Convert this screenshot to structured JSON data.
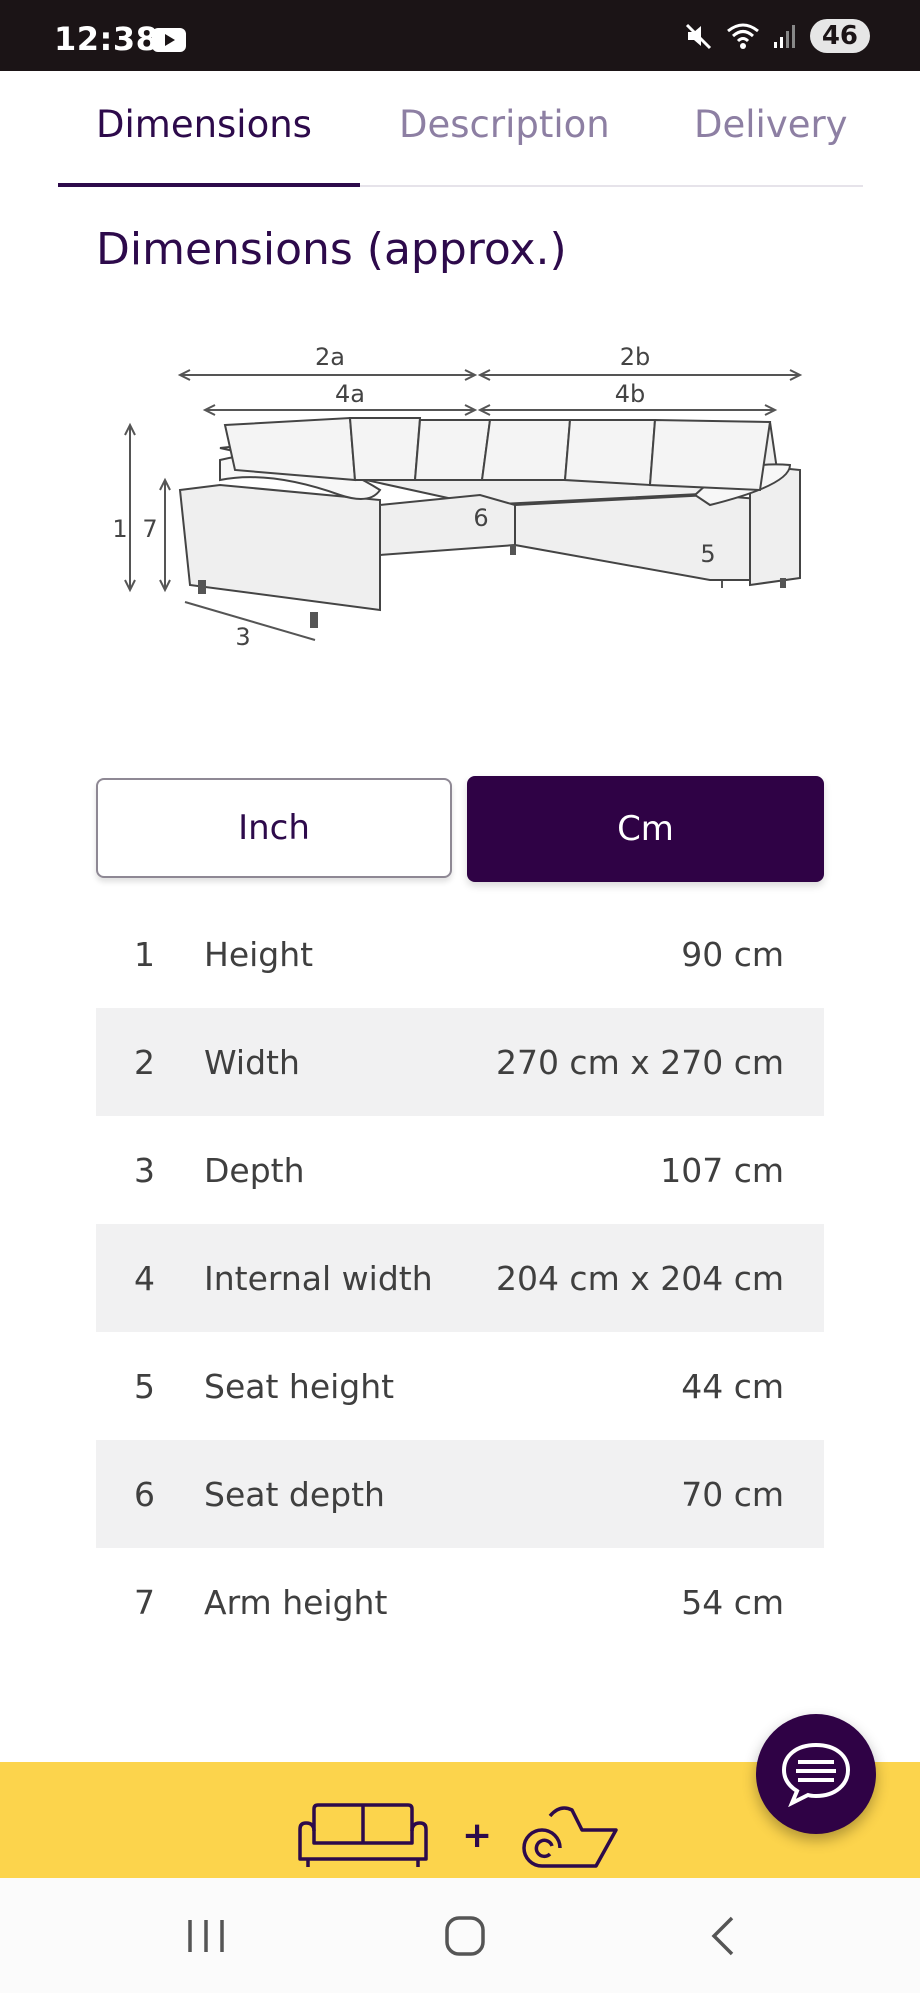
{
  "status_bar": {
    "time": "12:38",
    "battery": "46",
    "icons": [
      "youtube-icon",
      "mute-icon",
      "wifi-icon",
      "signal-icon"
    ]
  },
  "tabs": [
    {
      "label": "Dimensions",
      "active": true
    },
    {
      "label": "Description",
      "active": false
    },
    {
      "label": "Delivery",
      "active": false
    }
  ],
  "section_title": "Dimensions (approx.)",
  "diagram_labels": {
    "l2a": "2a",
    "l2b": "2b",
    "l4a": "4a",
    "l4b": "4b",
    "l1": "1",
    "l7": "7",
    "l3": "3",
    "l5": "5",
    "l6": "6"
  },
  "unit_toggle": {
    "inch": "Inch",
    "cm": "Cm",
    "selected": "Cm"
  },
  "dimensions": [
    {
      "num": "1",
      "label": "Height",
      "value": "90 cm"
    },
    {
      "num": "2",
      "label": "Width",
      "value": "270 cm x 270 cm"
    },
    {
      "num": "3",
      "label": "Depth",
      "value": "107 cm"
    },
    {
      "num": "4",
      "label": "Internal width",
      "value": "204 cm x 204 cm"
    },
    {
      "num": "5",
      "label": "Seat height",
      "value": "44 cm"
    },
    {
      "num": "6",
      "label": "Seat depth",
      "value": "70 cm"
    },
    {
      "num": "7",
      "label": "Arm height",
      "value": "54 cm"
    }
  ],
  "banner": {
    "plus": "+",
    "icons": [
      "sofa-icon",
      "rug-icon"
    ]
  },
  "colors": {
    "brand_purple": "#2f0245",
    "banner_yellow": "#fcd44c",
    "tab_inactive": "#8d7fa3"
  }
}
